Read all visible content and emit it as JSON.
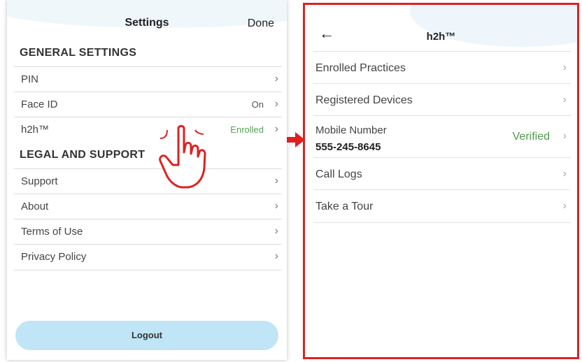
{
  "settings": {
    "title": "Settings",
    "done_label": "Done",
    "general_header": "GENERAL SETTINGS",
    "legal_header": "LEGAL AND SUPPORT",
    "general_items": [
      {
        "label": "PIN",
        "value": ""
      },
      {
        "label": "Face ID",
        "value": "On"
      },
      {
        "label": "h2h™",
        "value": "Enrolled"
      }
    ],
    "legal_items": [
      {
        "label": "Support"
      },
      {
        "label": "About"
      },
      {
        "label": "Terms of Use"
      },
      {
        "label": "Privacy Policy"
      }
    ],
    "logout_label": "Logout"
  },
  "h2h": {
    "title": "h2h™",
    "back_icon": "←",
    "items": [
      {
        "label": "Enrolled Practices"
      },
      {
        "label": "Registered Devices"
      },
      {
        "label": "Mobile Number",
        "value": "555-245-8645",
        "status": "Verified"
      },
      {
        "label": "Call Logs"
      },
      {
        "label": "Take a Tour"
      }
    ]
  },
  "icons": {
    "chevron": "›",
    "hand": "pointing-hand-icon",
    "arrow": "right-arrow-icon"
  },
  "colors": {
    "accent_red": "#e02020",
    "verified_green": "#4f9a4f",
    "logout_blue": "#bfe5f6"
  }
}
